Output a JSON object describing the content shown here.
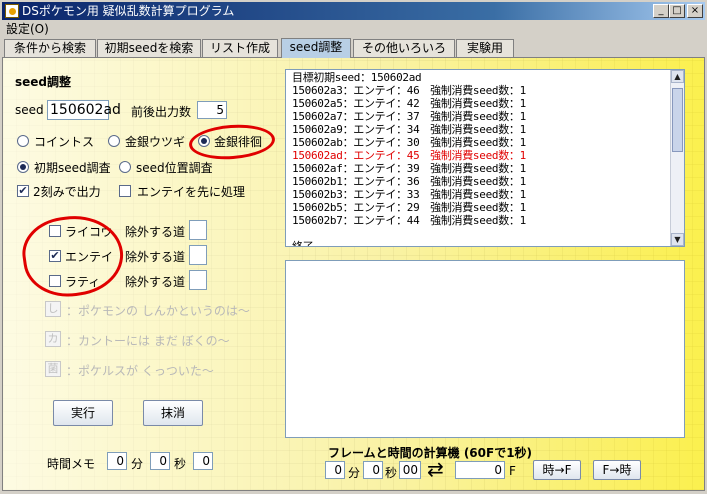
{
  "window": {
    "title": "DSポケモン用 疑似乱数計算プログラム",
    "minimize": "_",
    "maximize": "□",
    "close": "×"
  },
  "menu": {
    "settings": "設定(O)"
  },
  "tabs": [
    "条件から検索",
    "初期seedを検索",
    "リスト作成",
    "seed調整",
    "その他いろいろ",
    "実験用"
  ],
  "active_tab": "seed調整",
  "seed_panel": {
    "heading": "seed調整",
    "seed_label": "seed",
    "seed_value": "150602ad",
    "range_label": "前後出力数",
    "range_value": "5",
    "mode_radios": [
      "コイントス",
      "金銀ウツギ",
      "金銀徘徊"
    ],
    "mode_selected": "金銀徘徊",
    "search_radios": [
      "初期seed調査",
      "seed位置調査"
    ],
    "search_selected": "初期seed調査",
    "check_2step": "2刻みで出力",
    "check_2step_checked": true,
    "check_entei_first": "エンテイを先に処理",
    "check_entei_first_checked": false
  },
  "roamers": [
    {
      "name": "ライコウ",
      "checked": false,
      "exclude_label": "除外する道",
      "exclude_value": ""
    },
    {
      "name": "エンテイ",
      "checked": true,
      "exclude_label": "除外する道",
      "exclude_value": ""
    },
    {
      "name": "ラティ",
      "checked": false,
      "exclude_label": "除外する道",
      "exclude_value": ""
    }
  ],
  "disabled_options": [
    {
      "badge": "し",
      "text": "：ポケモンの しんかというのは～"
    },
    {
      "badge": "カ",
      "text": "：カントーには まだ ぼくの～"
    },
    {
      "badge": "菌",
      "text": "：ポケルスが くっついた～"
    }
  ],
  "buttons": {
    "run": "実行",
    "clear": "抹消"
  },
  "time_memo": {
    "label": "時間メモ",
    "minutes_value": "0",
    "minutes_unit": "分",
    "seconds_value": "0",
    "seconds_unit": "秒",
    "extra_value": "0"
  },
  "results": {
    "lines": [
      "目標初期seed：150602ad",
      "150602a3：エンテイ：46　強制消費seed数：1",
      "150602a5：エンテイ：42　強制消費seed数：1",
      "150602a7：エンテイ：37　強制消費seed数：1",
      "150602a9：エンテイ：34　強制消費seed数：1",
      "150602ab：エンテイ：30　強制消費seed数：1",
      "150602ad：エンテイ：45　強制消費seed数：1",
      "150602af：エンテイ：39　強制消費seed数：1",
      "150602b1：エンテイ：36　強制消費seed数：1",
      "150602b3：エンテイ：33　強制消費seed数：1",
      "150602b5：エンテイ：29　強制消費seed数：1",
      "150602b7：エンテイ：44　強制消費seed数：1",
      "",
      "終了"
    ],
    "highlight_index": 6,
    "highlight_color": "#e00000"
  },
  "calculator": {
    "title": "フレームと時間の計算機 (60Fで1秒)",
    "minutes_value": "0",
    "minutes_unit": "分",
    "seconds_value": "0",
    "seconds_unit": "秒",
    "frames_value": "00",
    "swap_icon": "⇄",
    "frame_count_value": "0",
    "frame_unit": "F",
    "time_to_frame_button": "時→F",
    "frame_to_time_button": "F→時"
  }
}
